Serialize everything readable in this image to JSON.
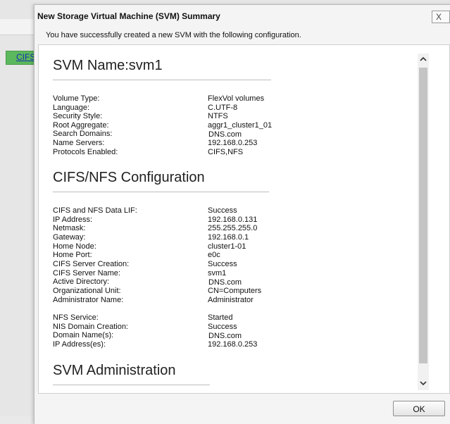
{
  "background": {
    "tab_label": "CIFS"
  },
  "dialog": {
    "title": "New Storage Virtual Machine (SVM) Summary",
    "close_label": "X",
    "message": "You have successfully created a new SVM with the following configuration.",
    "ok_label": "OK"
  },
  "svm_section": {
    "heading": "SVM Name:svm1",
    "fields": [
      {
        "label": "Volume Type:",
        "value": "FlexVol volumes"
      },
      {
        "label": "Language:",
        "value": "C.UTF-8"
      },
      {
        "label": "Security Style:",
        "value": "NTFS"
      },
      {
        "label": "Root Aggregate:",
        "value": "aggr1_cluster1_01"
      },
      {
        "label": "Search Domains:",
        "value": "DNS.com"
      },
      {
        "label": "Name Servers:",
        "value": "192.168.0.253"
      },
      {
        "label": "Protocols Enabled:",
        "value": "CIFS,NFS"
      }
    ]
  },
  "cifs_section": {
    "heading": "CIFS/NFS Configuration",
    "fields": [
      {
        "label": "CIFS and NFS Data LIF:",
        "value": "Success"
      },
      {
        "label": "IP Address:",
        "value": "192.168.0.131"
      },
      {
        "label": "Netmask:",
        "value": "255.255.255.0"
      },
      {
        "label": "Gateway:",
        "value": "192.168.0.1"
      },
      {
        "label": "Home Node:",
        "value": "cluster1-01"
      },
      {
        "label": "Home Port:",
        "value": "e0c"
      },
      {
        "label": "CIFS Server Creation:",
        "value": "Success"
      },
      {
        "label": "CIFS Server Name:",
        "value": "svm1"
      },
      {
        "label": "Active Directory:",
        "value": "DNS.com"
      },
      {
        "label": "Organizational Unit:",
        "value": "CN=Computers"
      },
      {
        "label": "Administrator Name:",
        "value": "Administrator"
      }
    ],
    "nfs_fields": [
      {
        "label": "NFS Service:",
        "value": "Started"
      },
      {
        "label": "NIS Domain Creation:",
        "value": "Success"
      },
      {
        "label": "Domain Name(s):",
        "value": "DNS.com"
      },
      {
        "label": "IP Address(es):",
        "value": "192.168.0.253"
      }
    ]
  },
  "admin_section": {
    "heading": "SVM Administration"
  },
  "scrollbar": {
    "up_icon": "chevron-up-icon",
    "down_icon": "chevron-down-icon"
  }
}
